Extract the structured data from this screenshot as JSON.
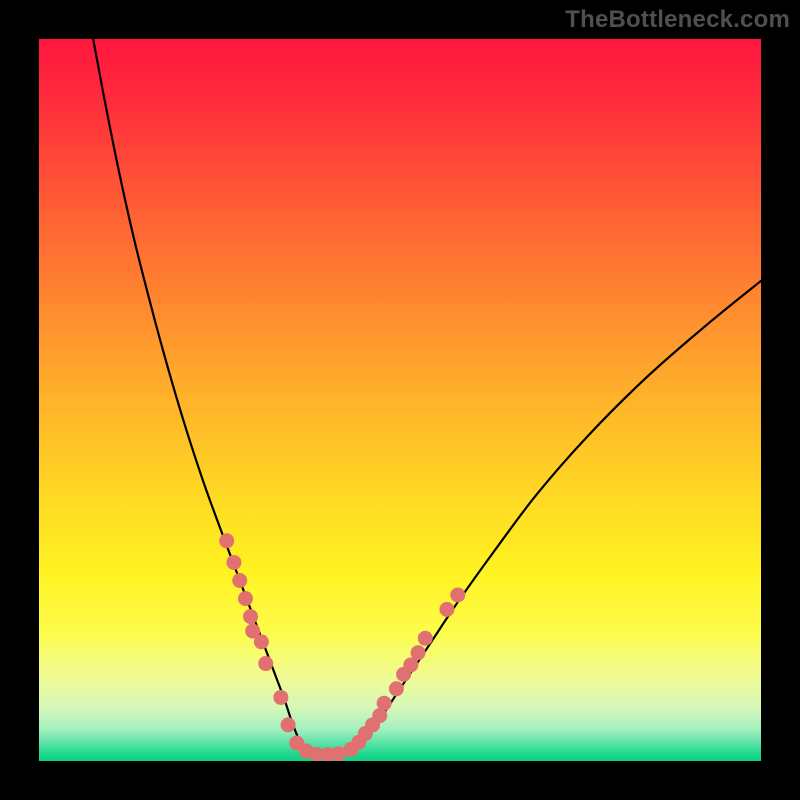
{
  "watermark": {
    "text": "TheBottleneck.com"
  },
  "chart_data": {
    "type": "line",
    "title": "",
    "xlabel": "",
    "ylabel": "",
    "xlim": [
      0,
      100
    ],
    "ylim": [
      0,
      100
    ],
    "grid": false,
    "legend": false,
    "background_gradient_stops": [
      {
        "offset": 0.0,
        "color": "#ff173e"
      },
      {
        "offset": 0.08,
        "color": "#ff2a3c"
      },
      {
        "offset": 0.2,
        "color": "#ff5336"
      },
      {
        "offset": 0.35,
        "color": "#ff8330"
      },
      {
        "offset": 0.5,
        "color": "#ffb32a"
      },
      {
        "offset": 0.62,
        "color": "#ffd524"
      },
      {
        "offset": 0.74,
        "color": "#fff321"
      },
      {
        "offset": 0.82,
        "color": "#fdfc4a"
      },
      {
        "offset": 0.88,
        "color": "#f1fb8f"
      },
      {
        "offset": 0.925,
        "color": "#d7f8b8"
      },
      {
        "offset": 0.955,
        "color": "#a7f0c0"
      },
      {
        "offset": 0.975,
        "color": "#5ce3a7"
      },
      {
        "offset": 0.99,
        "color": "#1fd98f"
      },
      {
        "offset": 1.0,
        "color": "#0fd084"
      }
    ],
    "series": [
      {
        "name": "bottleneck-curve",
        "color": "#000000",
        "stroke_width": 2.2,
        "x": [
          7.5,
          9,
          11,
          13,
          15,
          17,
          19,
          21,
          23,
          25,
          26.5,
          28,
          29.5,
          31,
          32.5,
          34,
          35,
          36,
          37,
          38,
          40,
          43,
          45,
          47,
          50,
          54,
          58,
          63,
          69,
          76,
          84,
          92,
          100
        ],
        "y": [
          100,
          92,
          82,
          73,
          65,
          57.5,
          50.5,
          44,
          38,
          32.5,
          28.5,
          24.5,
          20.5,
          16.5,
          12.5,
          8.5,
          5.5,
          3.0,
          1.5,
          0.8,
          0.5,
          1.3,
          3.0,
          5.5,
          10,
          16,
          22,
          29,
          37,
          45,
          53,
          60,
          66.5
        ]
      }
    ],
    "markers": {
      "name": "fit-points",
      "color": "#e17070",
      "radius": 7.5,
      "points": [
        {
          "x": 26.0,
          "y": 30.5
        },
        {
          "x": 27.0,
          "y": 27.5
        },
        {
          "x": 27.8,
          "y": 25.0
        },
        {
          "x": 28.6,
          "y": 22.5
        },
        {
          "x": 29.3,
          "y": 20.0
        },
        {
          "x": 29.6,
          "y": 18.0
        },
        {
          "x": 30.8,
          "y": 16.5
        },
        {
          "x": 31.4,
          "y": 13.5
        },
        {
          "x": 33.5,
          "y": 8.8
        },
        {
          "x": 34.5,
          "y": 5.0
        },
        {
          "x": 35.7,
          "y": 2.5
        },
        {
          "x": 37.0,
          "y": 1.4
        },
        {
          "x": 38.5,
          "y": 0.9
        },
        {
          "x": 40.0,
          "y": 0.9
        },
        {
          "x": 41.5,
          "y": 1.0
        },
        {
          "x": 43.2,
          "y": 1.6
        },
        {
          "x": 44.3,
          "y": 2.6
        },
        {
          "x": 45.2,
          "y": 3.8
        },
        {
          "x": 46.2,
          "y": 5.0
        },
        {
          "x": 47.2,
          "y": 6.3
        },
        {
          "x": 47.8,
          "y": 8.0
        },
        {
          "x": 49.5,
          "y": 10.0
        },
        {
          "x": 50.5,
          "y": 12.0
        },
        {
          "x": 51.5,
          "y": 13.3
        },
        {
          "x": 52.5,
          "y": 15.0
        },
        {
          "x": 53.5,
          "y": 17.0
        },
        {
          "x": 56.5,
          "y": 21.0
        },
        {
          "x": 58.0,
          "y": 23.0
        }
      ]
    }
  }
}
